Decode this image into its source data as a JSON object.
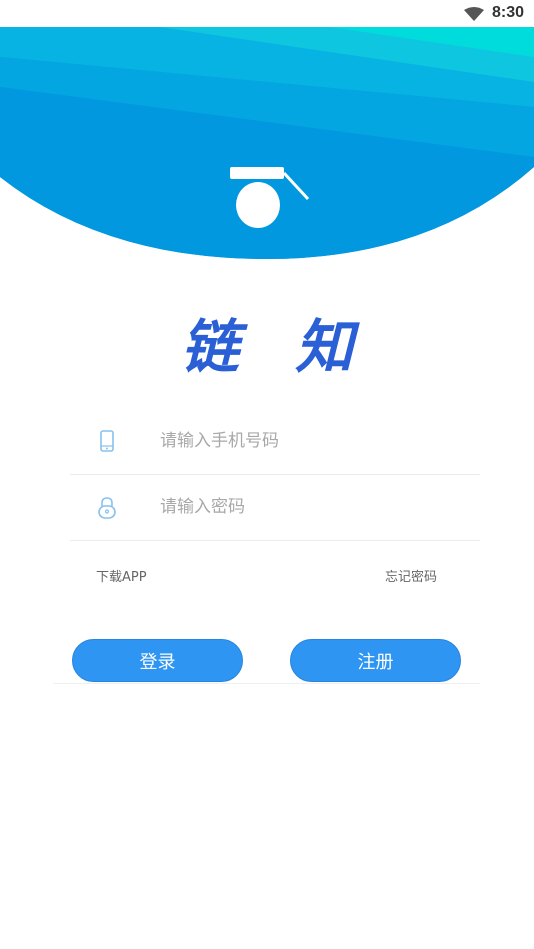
{
  "status_bar": {
    "time": "8:30",
    "wifi_icon": "wifi-icon"
  },
  "header": {
    "logo_icon": "graduation-cap-icon",
    "colors": {
      "gradient_start": "#00e3dc",
      "gradient_end": "#0090e0"
    }
  },
  "brand": {
    "title": "链 知",
    "color": "#2a5fd6"
  },
  "form": {
    "phone": {
      "icon": "phone-icon",
      "placeholder": "请输入手机号码",
      "value": ""
    },
    "password": {
      "icon": "lock-icon",
      "placeholder": "请输入密码",
      "value": ""
    }
  },
  "links": {
    "download": "下载APP",
    "forgot_password": "忘记密码"
  },
  "buttons": {
    "login": "登录",
    "register": "注册",
    "color": "#2e95f3"
  }
}
